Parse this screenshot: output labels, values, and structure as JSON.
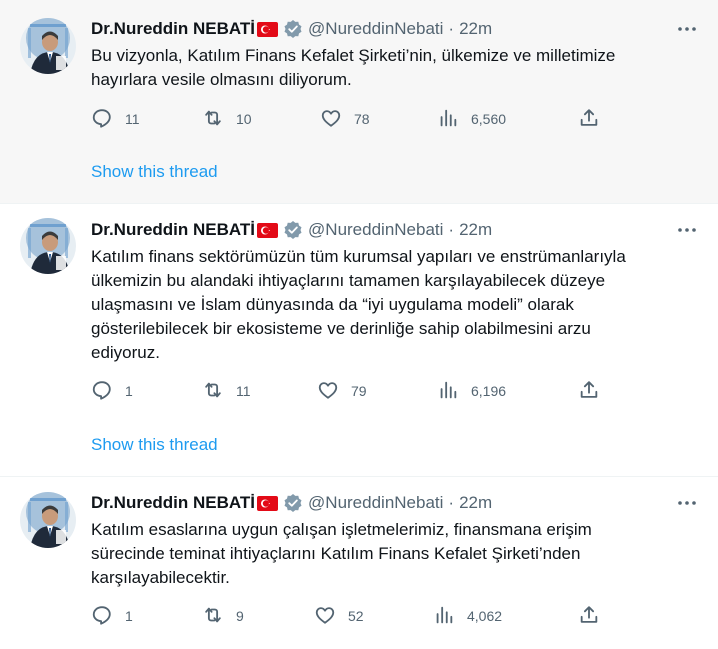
{
  "tweets": [
    {
      "name": "Dr.Nureddin NEBATİ",
      "handle": "@NureddinNebati",
      "separator": "·",
      "time": "22m",
      "text_lines": [
        "Bu vizyonla, Katılım Finans Kefalet Şirketi’nin, ülkemize ve milletimize",
        "hayırlara vesile olmasını diliyorum."
      ],
      "replies": "11",
      "retweets": "10",
      "likes": "78",
      "views": "6,560",
      "show_thread": "Show this thread"
    },
    {
      "name": "Dr.Nureddin NEBATİ",
      "handle": "@NureddinNebati",
      "separator": "·",
      "time": "22m",
      "text_lines": [
        "Katılım finans sektörümüzün tüm kurumsal yapıları ve enstrümanlarıyla",
        "ülkemizin bu alandaki ihtiyaçlarını tamamen karşılayabilecek düzeye",
        "ulaşmasını ve İslam dünyasında da “iyi uygulama modeli” olarak",
        "gösterilebilecek bir ekosisteme ve derinliğe sahip olabilmesini arzu",
        "ediyoruz."
      ],
      "replies": "1",
      "retweets": "11",
      "likes": "79",
      "views": "6,196",
      "show_thread": "Show this thread"
    },
    {
      "name": "Dr.Nureddin NEBATİ",
      "handle": "@NureddinNebati",
      "separator": "·",
      "time": "22m",
      "text_lines": [
        "Katılım esaslarına uygun çalışan işletmelerimiz, finansmana erişim",
        "sürecinde teminat ihtiyaçlarını Katılım Finans Kefalet Şirketi’nden",
        "karşılayabilecektir."
      ],
      "replies": "1",
      "retweets": "9",
      "likes": "52",
      "views": "4,062"
    }
  ],
  "icons": {
    "verified": "verified-badge-icon",
    "flag": "turkey-flag-icon",
    "more": "more-icon",
    "reply": "reply-icon",
    "retweet": "retweet-icon",
    "like": "like-icon",
    "views": "views-icon",
    "share": "share-icon"
  },
  "colors": {
    "accent": "#1d9bf0",
    "secondary_text": "#536471",
    "highlight_bg": "#f7f7f7",
    "verified_gray": "#829aab",
    "flag_red": "#e30a17"
  }
}
